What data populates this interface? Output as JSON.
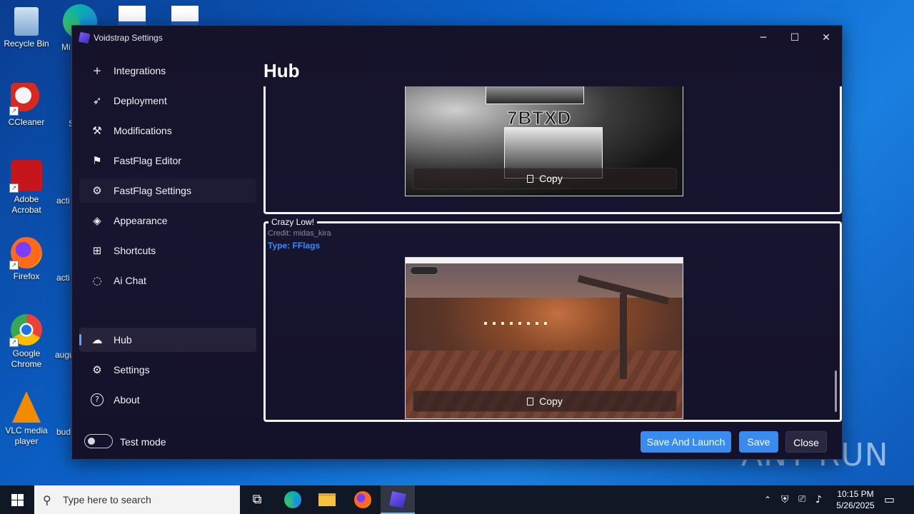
{
  "desktop": {
    "icons": [
      {
        "label": "Recycle Bin"
      },
      {
        "label": "CCleaner"
      },
      {
        "label": "Adobe Acrobat"
      },
      {
        "label": "Firefox"
      },
      {
        "label": "Google Chrome"
      },
      {
        "label": "VLC media player"
      }
    ],
    "partial_labels": [
      "Mi",
      "S",
      "acti",
      "acti",
      "augu",
      "bud"
    ]
  },
  "window": {
    "title": "Voidstrap Settings",
    "controls": {
      "minimize": "─",
      "maximize": "☐",
      "close": "✕"
    }
  },
  "sidebar": {
    "items": [
      {
        "label": "Integrations",
        "icon": "plus-icon",
        "glyph": "+"
      },
      {
        "label": "Deployment",
        "icon": "rocket-icon",
        "glyph": "➶"
      },
      {
        "label": "Modifications",
        "icon": "wrench-icon",
        "glyph": "⚒"
      },
      {
        "label": "FastFlag Editor",
        "icon": "flag-icon",
        "glyph": "⚑"
      },
      {
        "label": "FastFlag Settings",
        "icon": "gear-icon",
        "glyph": "⚙"
      },
      {
        "label": "Appearance",
        "icon": "paint-bucket-icon",
        "glyph": "◈"
      },
      {
        "label": "Shortcuts",
        "icon": "grid-icon",
        "glyph": "⊞"
      },
      {
        "label": "Ai Chat",
        "icon": "chat-icon",
        "glyph": "◌"
      },
      {
        "label": "Hub",
        "icon": "cloud-icon",
        "glyph": "☁"
      },
      {
        "label": "Settings",
        "icon": "gear-icon",
        "glyph": "⚙"
      },
      {
        "label": "About",
        "icon": "help-icon",
        "glyph": "?"
      }
    ],
    "active": "Hub",
    "test_mode": {
      "label": "Test mode",
      "enabled": false
    }
  },
  "main": {
    "title": "Hub",
    "cards": [
      {
        "preview_watermark": "7BTXD",
        "copy_label": "Copy"
      },
      {
        "title": "Crazy Low!",
        "credit": "Credit: midas_kira",
        "type": "Type: FFlags",
        "copy_label": "Copy"
      }
    ]
  },
  "footer": {
    "save_and_launch": "Save And Launch",
    "save": "Save",
    "close": "Close"
  },
  "watermark": "ANY RUN",
  "taskbar": {
    "search_placeholder": "Type here to search",
    "time": "10:15 PM",
    "date": "5/26/2025"
  },
  "colors": {
    "accent": "#3a8bf0",
    "type_label": "#2f8cff",
    "window_bg": "#16132d"
  }
}
